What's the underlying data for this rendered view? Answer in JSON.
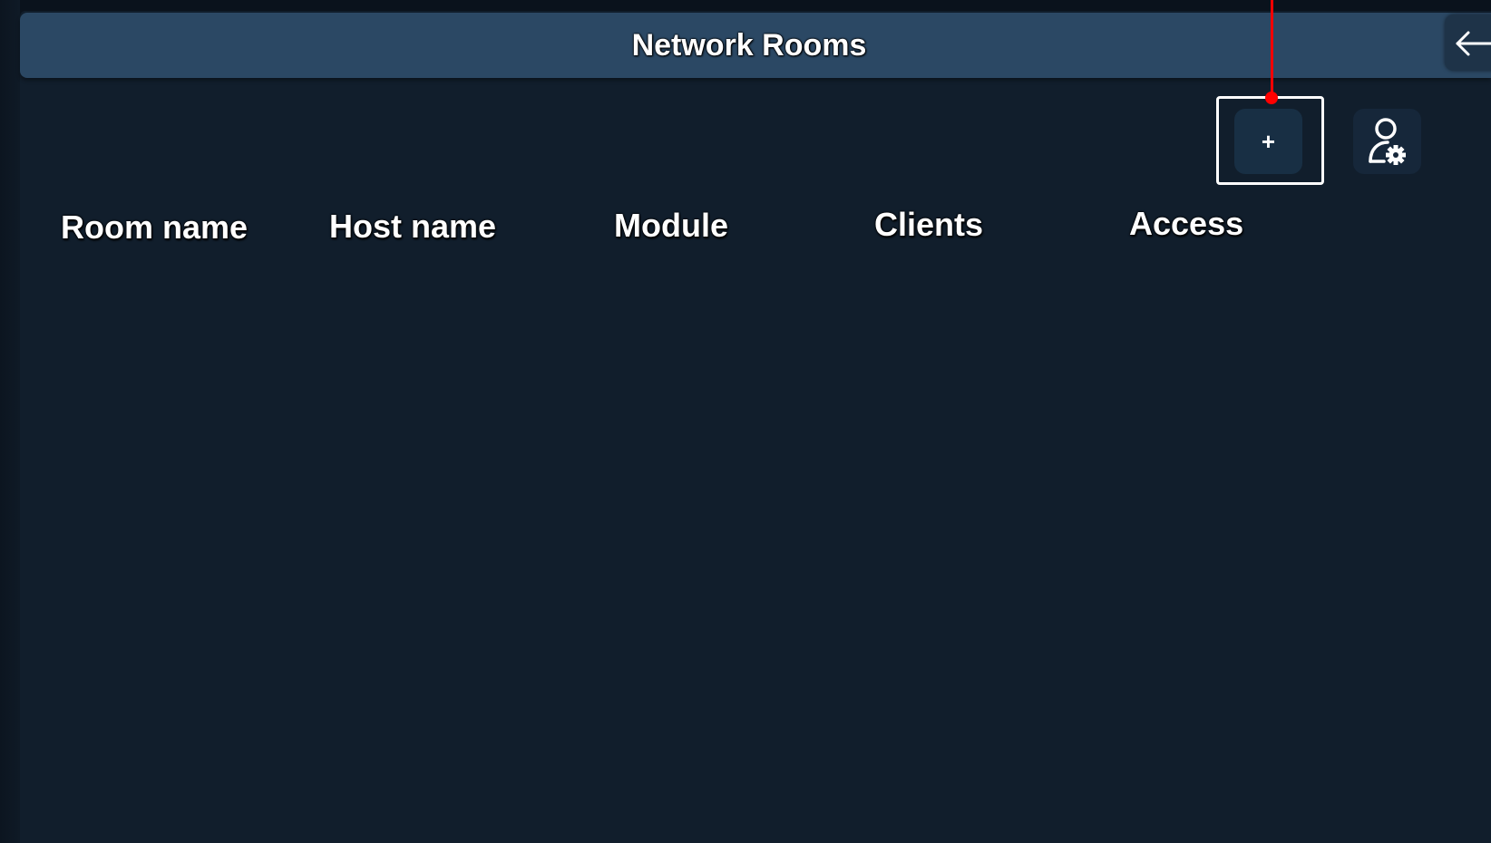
{
  "header": {
    "title": "Network Rooms"
  },
  "toolbar": {
    "add_room_label": "+",
    "user_settings_icon": "user-gear-icon",
    "back_icon": "back-arrow-icon"
  },
  "table": {
    "columns": [
      "Room name",
      "Host name",
      "Module",
      "Clients",
      "Access"
    ],
    "rows": []
  },
  "colors": {
    "background": "#111e2c",
    "header": "#2b4864",
    "highlight": "#ffffff",
    "pointer": "#ff0000"
  }
}
